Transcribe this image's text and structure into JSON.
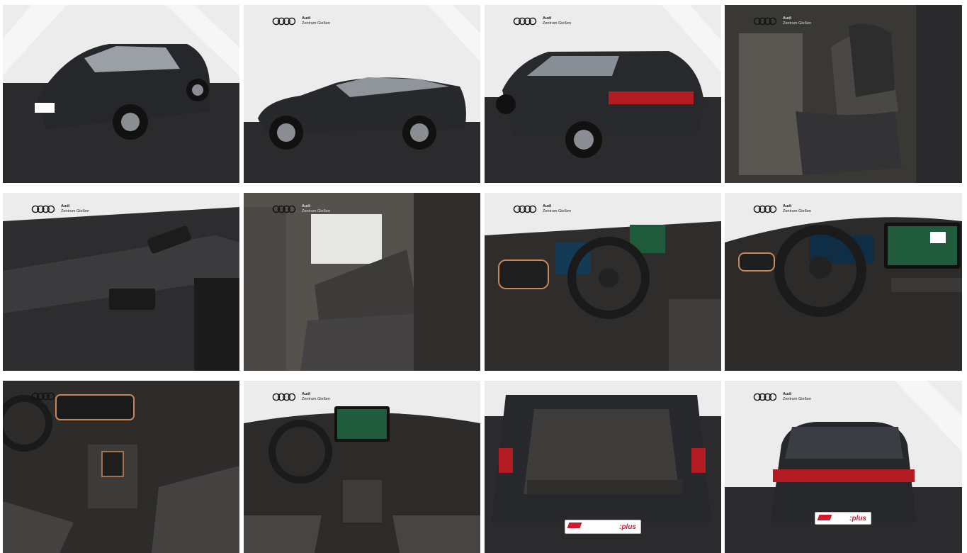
{
  "dealer": {
    "brand": "Audi",
    "location": "Zentrum Gießen"
  },
  "plates": {
    "plus": ":plus"
  },
  "photos": [
    {
      "view": "exterior-front-three-quarter"
    },
    {
      "view": "exterior-side"
    },
    {
      "view": "exterior-rear-three-quarter"
    },
    {
      "view": "front-seats"
    },
    {
      "view": "door-panel"
    },
    {
      "view": "rear-seats"
    },
    {
      "view": "cockpit-side"
    },
    {
      "view": "cockpit-front"
    },
    {
      "view": "center-console"
    },
    {
      "view": "dashboard-wide"
    },
    {
      "view": "trunk"
    },
    {
      "view": "exterior-rear"
    }
  ],
  "colors": {
    "studio_wall": "#e9e9ea",
    "studio_floor": "#2b2b2d",
    "car_body": "#2a2b2e",
    "cupra_copper": "#c8875a",
    "tail_red": "#b31b22"
  }
}
